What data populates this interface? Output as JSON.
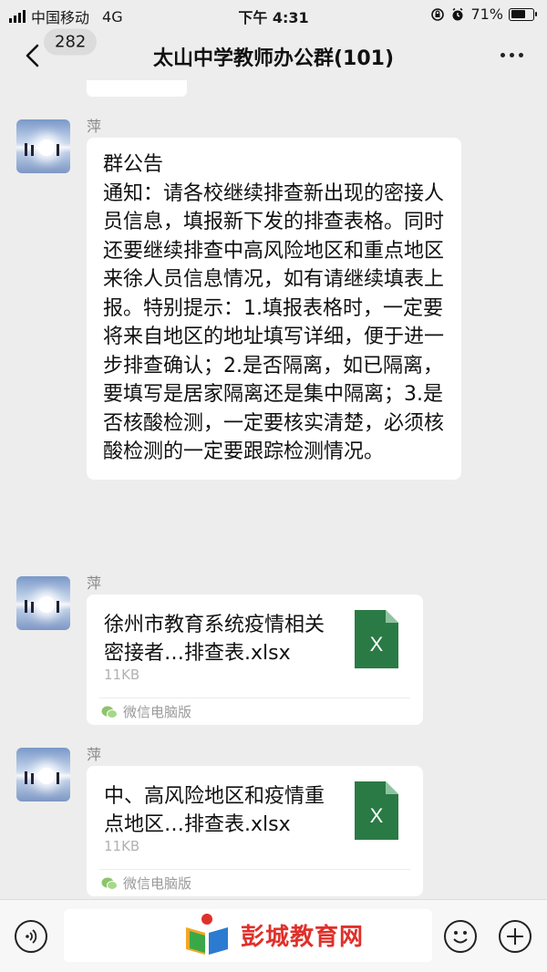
{
  "status_bar": {
    "carrier": "中国移动",
    "network": "4G",
    "time": "下午 4:31",
    "battery_percent": "71%",
    "battery_level": 0.71
  },
  "nav": {
    "unread_count": "282",
    "title": "太山中学教师办公群(101)"
  },
  "messages": [
    {
      "sender": "萍",
      "type": "text",
      "title": "群公告",
      "body": "通知：请各校继续排查新出现的密接人员信息，填报新下发的排查表格。同时还要继续排查中高风险地区和重点地区来徐人员信息情况，如有请继续填表上报。特别提示：1.填报表格时，一定要将来自地区的地址填写详细，便于进一步排查确认；2.是否隔离，如已隔离，要填写是居家隔离还是集中隔离；3.是否核酸检测，一定要核实清楚，必须核酸检测的一定要跟踪检测情况。"
    },
    {
      "sender": "萍",
      "type": "file",
      "file_name": "徐州市教育系统疫情相关密接者…排查表.xlsx",
      "file_size": "11KB",
      "source": "微信电脑版",
      "file_icon_letter": "X"
    },
    {
      "sender": "萍",
      "type": "file",
      "file_name": "中、高风险地区和疫情重点地区…排查表.xlsx",
      "file_size": "11KB",
      "source": "微信电脑版",
      "file_icon_letter": "X"
    }
  ],
  "input_bar": {
    "watermark": "彭城教育网"
  },
  "colors": {
    "background": "#ededed",
    "bubble": "#ffffff",
    "excel_green": "#2a7a45",
    "watermark_red": "#e0302a"
  }
}
